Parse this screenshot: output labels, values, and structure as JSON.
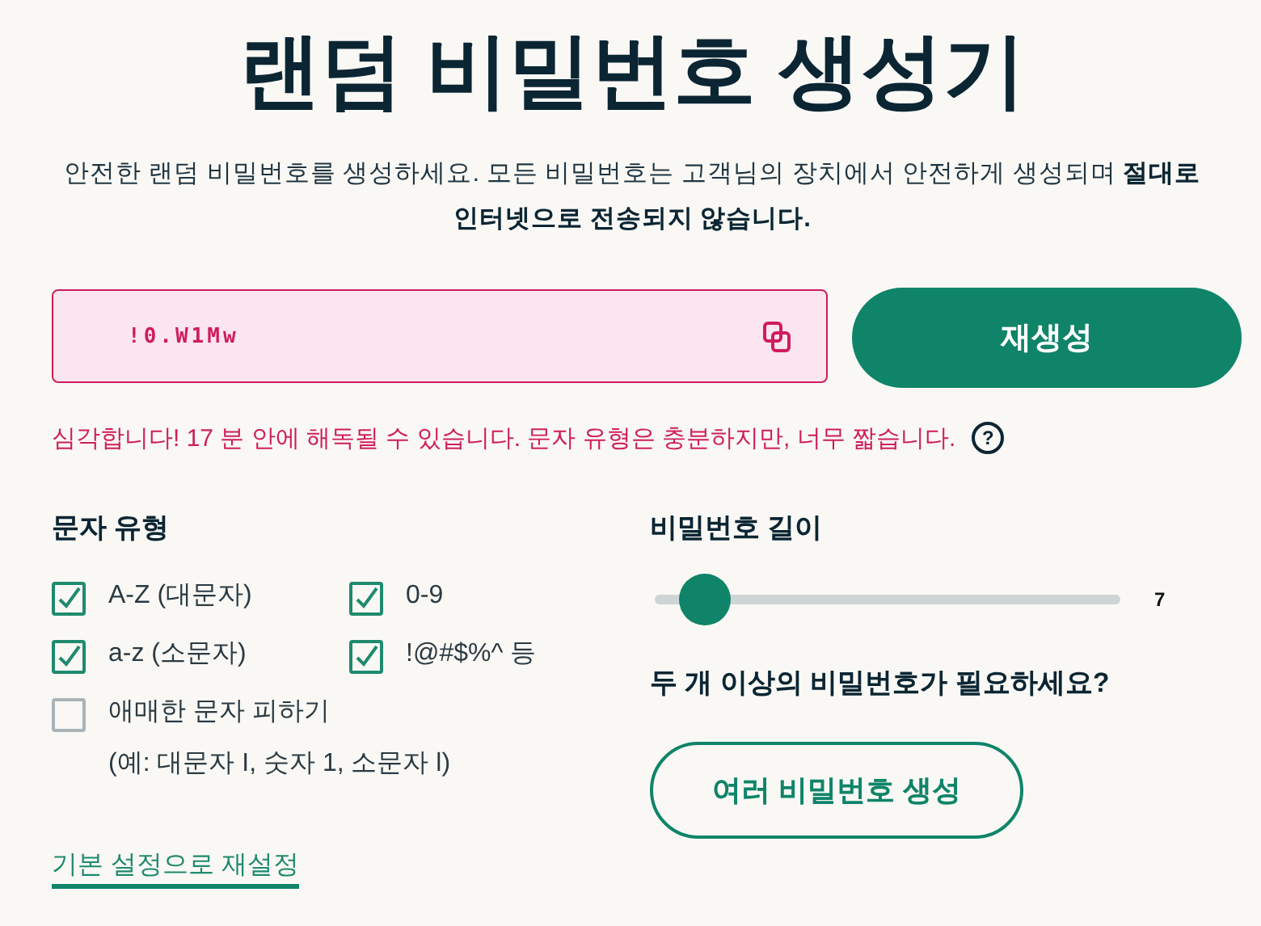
{
  "title": "랜덤 비밀번호 생성기",
  "description": "안전한 랜덤 비밀번호를 생성하세요. 모든 비밀번호는 고객님의 장치에서 안전하게 생성되며 **절대로 인터넷으로 전송되지 않습니다.**",
  "password": {
    "value": "!0.W1Mw"
  },
  "regenerate_button": "재생성",
  "strength_message": "심각합니다! 17 분 안에 해독될 수 있습니다. 문자 유형은 충분하지만, 너무 짧습니다.",
  "help_icon": "?",
  "character_types": {
    "heading": "문자 유형",
    "options": [
      {
        "label": "A-Z (대문자)",
        "checked": true
      },
      {
        "label": "0-9",
        "checked": true
      },
      {
        "label": "a-z (소문자)",
        "checked": true
      },
      {
        "label": "!@#$%^ 등",
        "checked": true
      },
      {
        "label": "애매한 문자 피하기",
        "checked": false,
        "note": "(예: 대문자 I, 숫자 1, 소문자 l)"
      }
    ]
  },
  "reset_link": "기본 설정으로 재설정",
  "length": {
    "heading": "비밀번호 길이",
    "level": 0.06,
    "value": "7"
  },
  "multiple": {
    "question": "두 개 이상의 비밀번호가 필요하세요?",
    "button": "여러 비밀번호 생성"
  }
}
